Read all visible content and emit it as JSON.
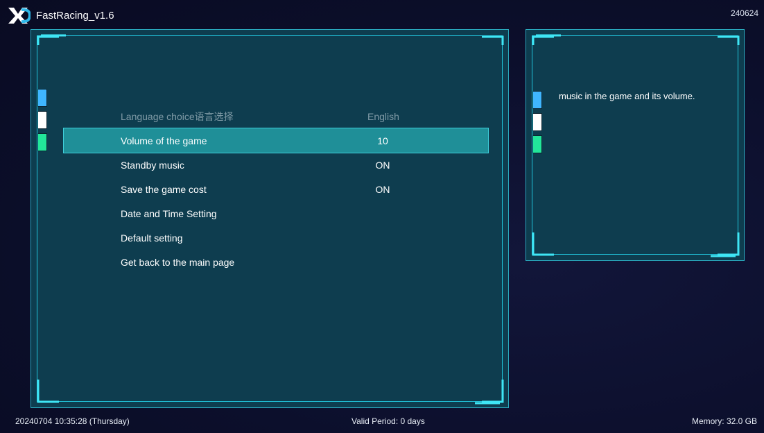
{
  "app": {
    "title": "FastRacing_v1.6",
    "build_code": "240624"
  },
  "colors": {
    "panel_bg": "#0e3d4f",
    "accent_cyan": "#21c6dd",
    "selected_row": "#1f8f98",
    "tab_blue": "#3fb6ff",
    "tab_white": "#ffffff",
    "tab_green": "#22e69a"
  },
  "menu": [
    {
      "label": "Language choice语言选择",
      "value": "English",
      "state": "disabled"
    },
    {
      "label": "Volume of the game",
      "value": "10",
      "state": "selected"
    },
    {
      "label": "Standby music",
      "value": "ON",
      "state": "normal"
    },
    {
      "label": "Save the game cost",
      "value": "ON",
      "state": "normal"
    },
    {
      "label": "Date and Time Setting",
      "value": "",
      "state": "normal"
    },
    {
      "label": "Default setting",
      "value": "",
      "state": "normal"
    },
    {
      "label": "Get back to the main page",
      "value": "",
      "state": "normal"
    }
  ],
  "info": {
    "text": "music in the game and its volume."
  },
  "footer": {
    "datetime": "20240704 10:35:28 (Thursday)",
    "valid_period": "Valid Period: 0 days",
    "memory": "Memory: 32.0 GB"
  },
  "icons": {
    "logo": "xc-logo-icon"
  }
}
